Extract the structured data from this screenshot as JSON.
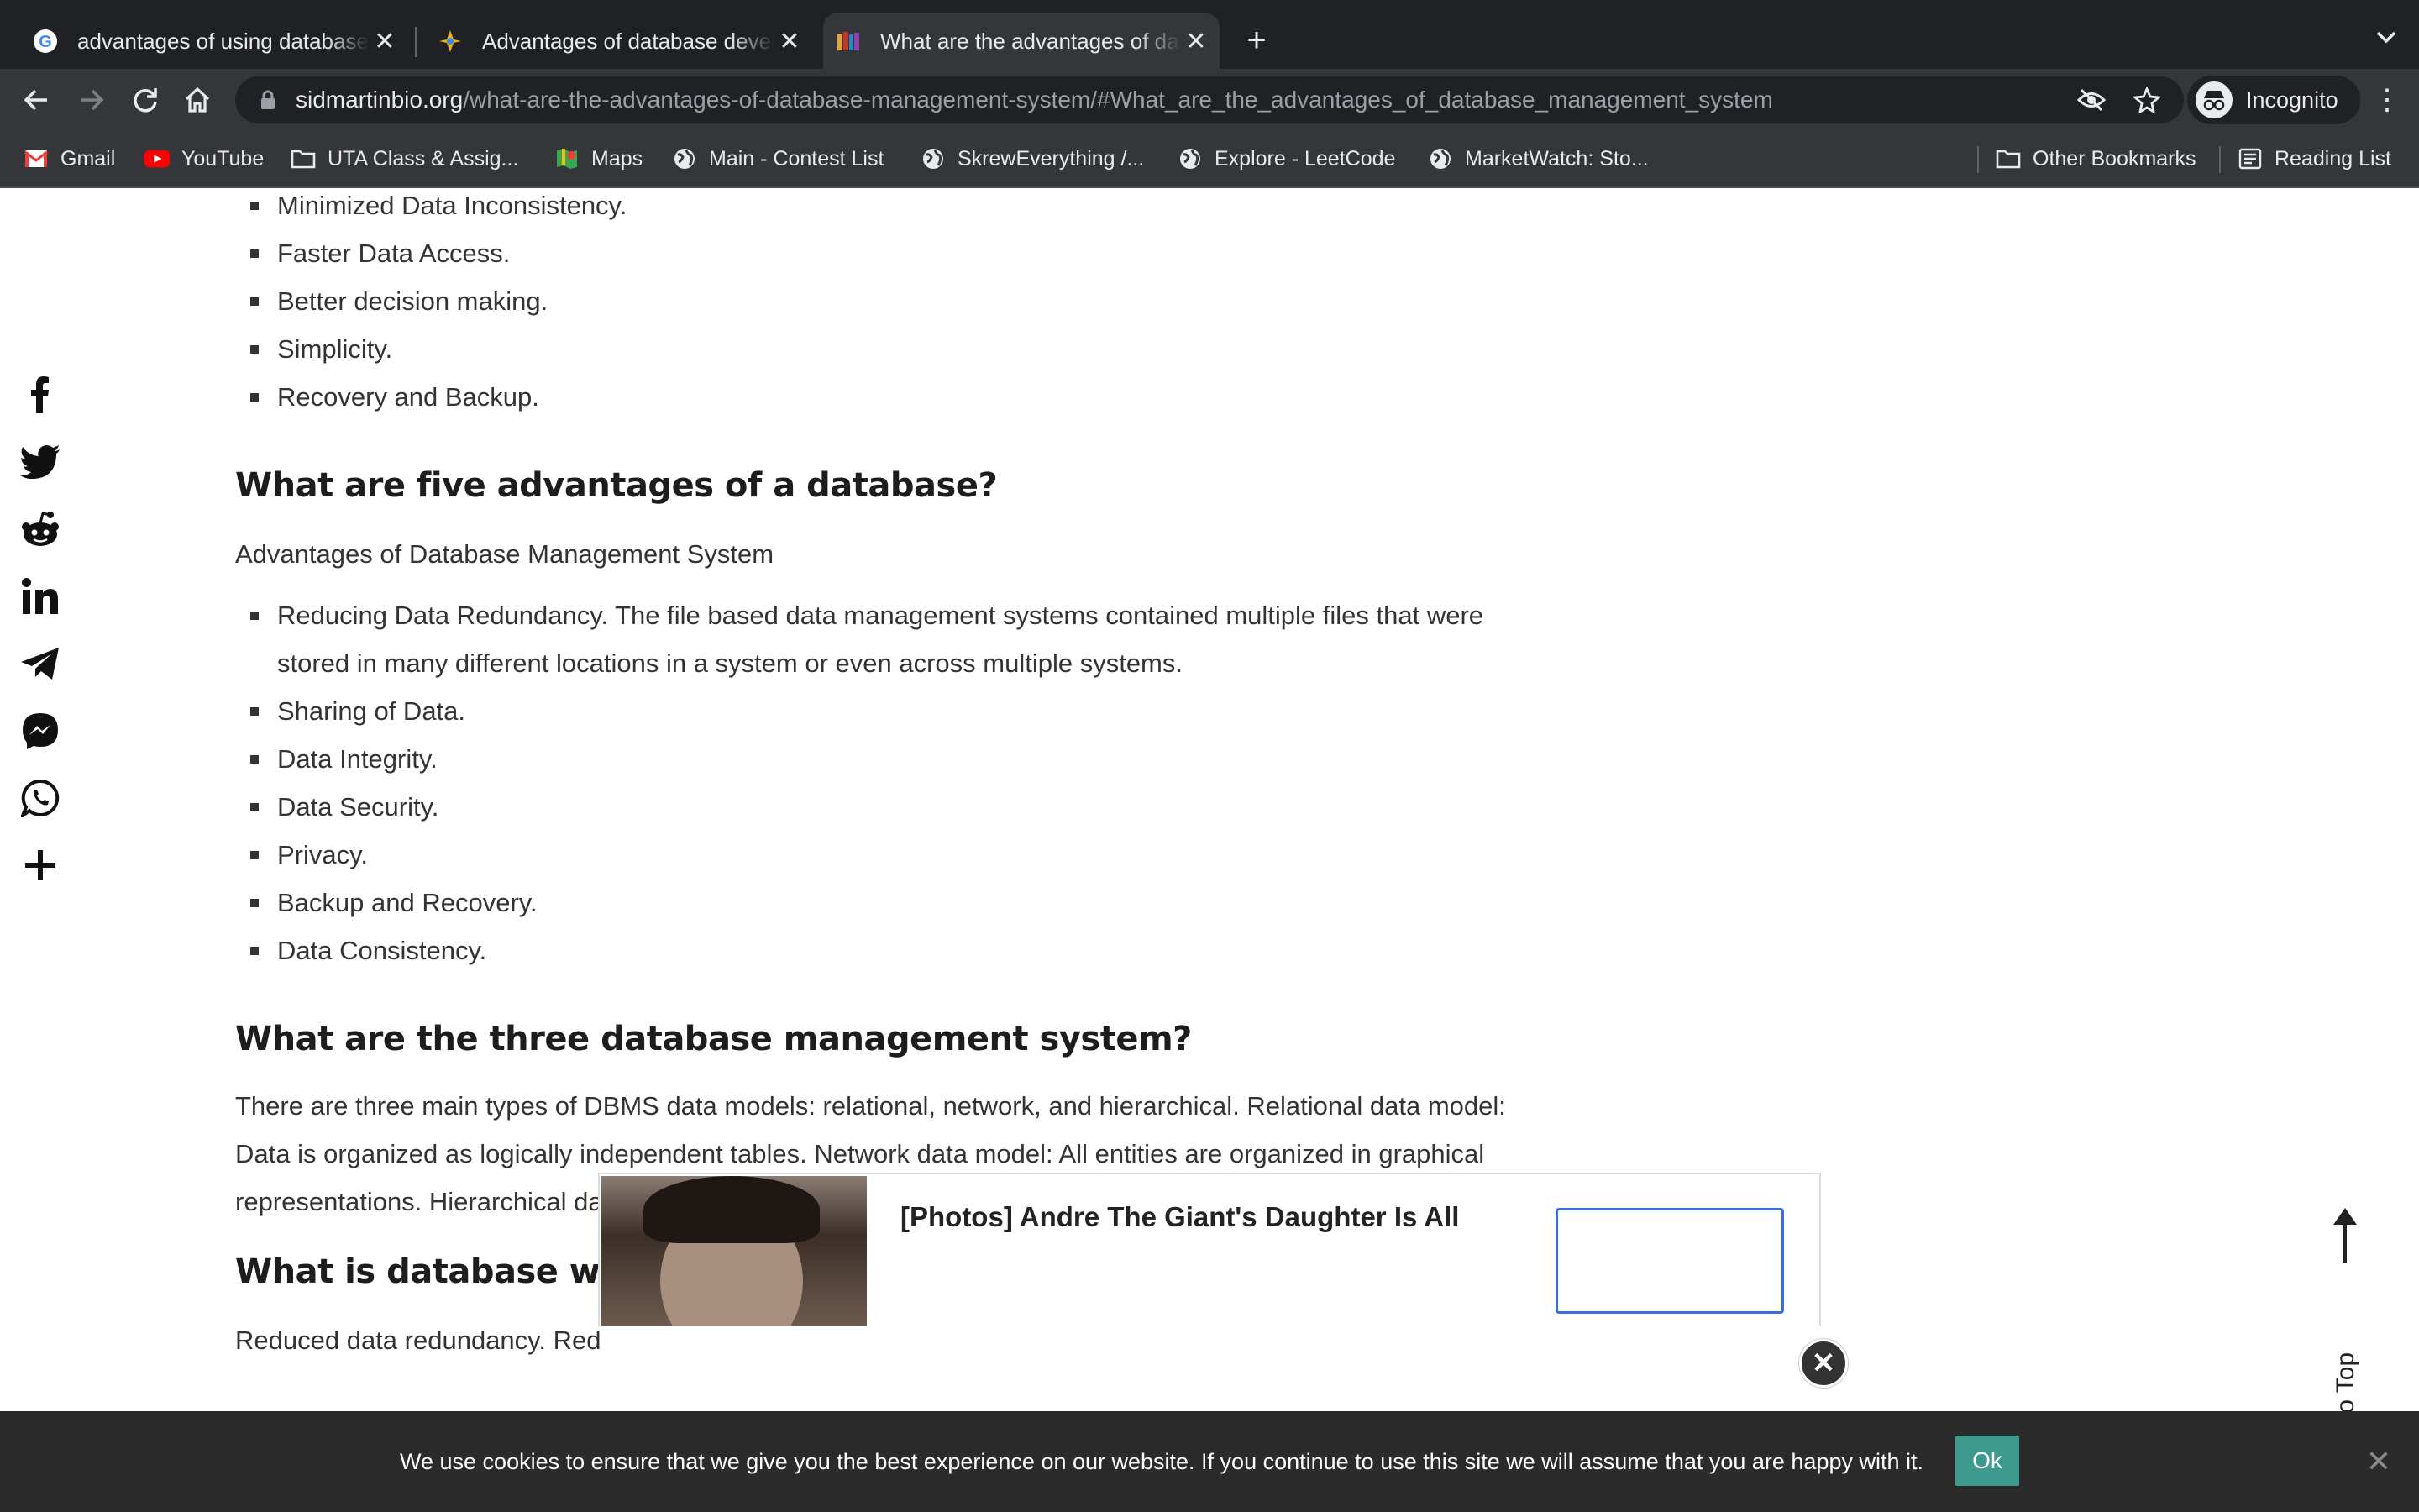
{
  "tabs": [
    {
      "title": "advantages of using database",
      "favicon": "google-icon",
      "active": false
    },
    {
      "title": "Advantages of database develo",
      "favicon": "bard-sparkle-icon",
      "active": false
    },
    {
      "title": "What are the advantages of dat",
      "favicon": "books-icon",
      "active": true
    }
  ],
  "toolbar": {
    "url_host": "sidmartinbio.org",
    "url_path": "/what-are-the-advantages-of-database-management-system/#What_are_the_advantages_of_database_management_system",
    "profile_label": "Incognito"
  },
  "bookmarks": [
    {
      "label": "Gmail",
      "icon": "gmail-icon"
    },
    {
      "label": "YouTube",
      "icon": "youtube-icon"
    },
    {
      "label": "UTA Class & Assig...",
      "icon": "folder-icon"
    },
    {
      "label": "Maps",
      "icon": "maps-icon"
    },
    {
      "label": "Main - Contest List",
      "icon": "globe-icon"
    },
    {
      "label": "SkrewEverything /...",
      "icon": "globe-icon"
    },
    {
      "label": "Explore - LeetCode",
      "icon": "globe-icon"
    },
    {
      "label": "MarketWatch: Sto...",
      "icon": "globe-icon"
    }
  ],
  "bookmarks_right": {
    "other": "Other Bookmarks",
    "reading": "Reading List"
  },
  "article": {
    "top_list": [
      "Minimized Data Inconsistency.",
      "Faster Data Access.",
      "Better decision making.",
      "Simplicity.",
      "Recovery and Backup."
    ],
    "h_five": "What are five advantages of a database?",
    "p_five": "Advantages of Database Management System",
    "five_list": [
      "Reducing Data Redundancy. The file based data management systems contained multiple files that were stored in many different locations in a system or even across multiple systems.",
      "Sharing of Data.",
      "Data Integrity.",
      "Data Security.",
      "Privacy.",
      "Backup and Recovery.",
      "Data Consistency."
    ],
    "h_three": "What are the three database management system?",
    "p_three": "There are three main types of DBMS data models: relational, network, and hierarchical. Relational data model: Data is organized as logically independent tables. Network data model: All entities are organized in graphical representations. Hierarchical data model: Data is organized into a tree-like structure.",
    "h_write": "What is database write three advantages of a database?",
    "p_write": "Reduced data redundancy. Red"
  },
  "share_icons": [
    "facebook-icon",
    "twitter-icon",
    "reddit-icon",
    "linkedin-icon",
    "telegram-icon",
    "messenger-icon",
    "whatsapp-icon",
    "more-plus-icon"
  ],
  "back_to_top": "Back To Top",
  "ad": {
    "headline": "[Photos] Andre The Giant's Daughter Is All"
  },
  "cookie": {
    "message": "We use cookies to ensure that we give you the best experience on our website. If you continue to use this site we will assume that you are happy with it.",
    "ok_label": "Ok"
  },
  "colors": {
    "chrome_dark": "#202124",
    "chrome_mid": "#35363a",
    "ok_button": "#3e9a8e",
    "cookie_bar": "#2b2b2b"
  }
}
